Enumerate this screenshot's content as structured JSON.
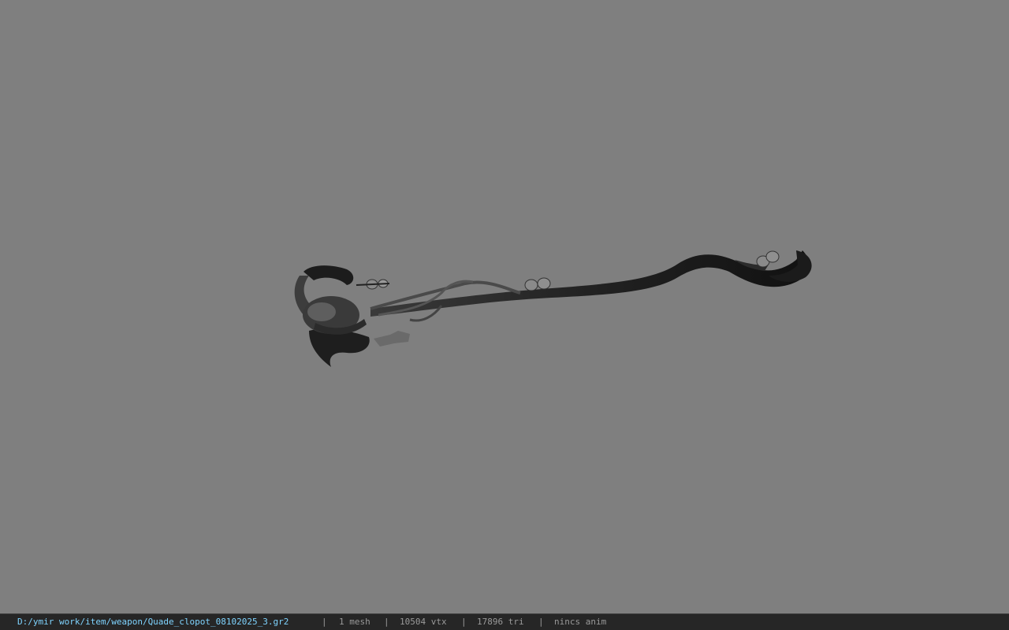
{
  "viewer": {
    "background_color": "#7f7f7f",
    "model_name": "staff-model"
  },
  "status_bar": {
    "file_path": "D:/ymir work/item/weapon/Quade_clopot_08102025_3.gr2",
    "separator": "|",
    "mesh_count": "1 mesh",
    "vertex_count": "10504 vtx",
    "triangle_count": "17896 tri",
    "animation": "nincs anim",
    "path_color": "#7fd4ff",
    "text_color": "#9a9a9a",
    "background": "#262626"
  }
}
